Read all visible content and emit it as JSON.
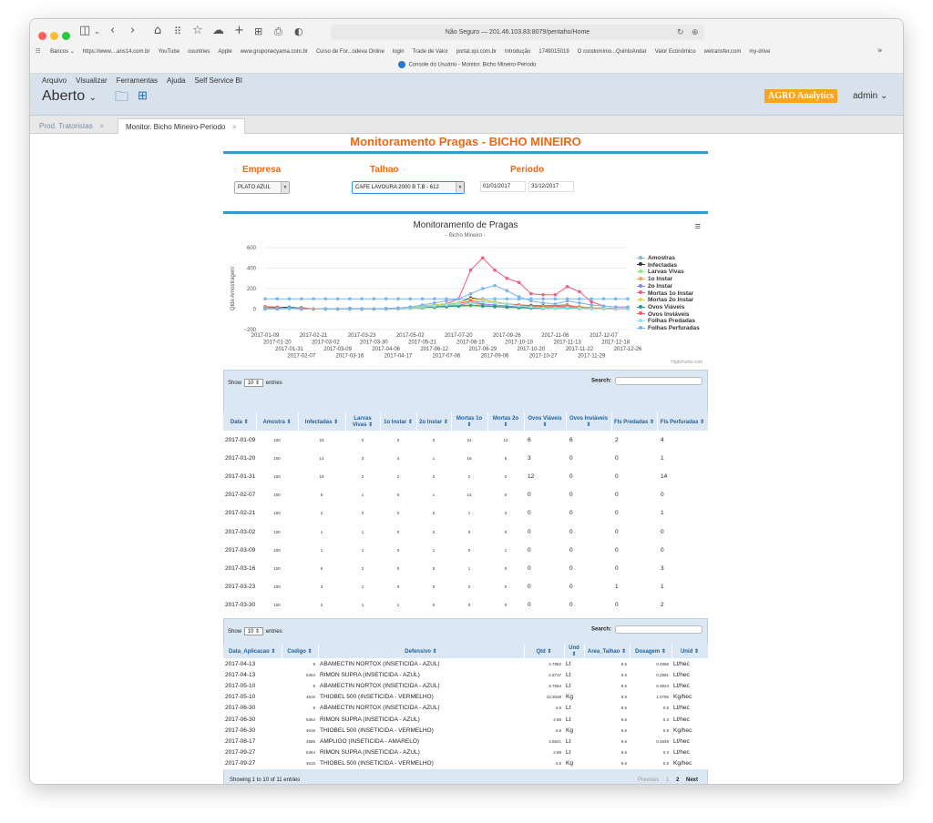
{
  "browser": {
    "url_prefix": "Não Seguro — ",
    "url": "201.46.103.83:8079/pentaho/Home",
    "tab_title": "Console do Usuário - Monitor. Bicho Mineiro-Periodo",
    "bookmarks": [
      "Bancos ⌄",
      "https://www....ans14.com.br",
      "YouTube",
      "countries",
      "Apple",
      "www.gruponecyama.com.br",
      "Curso de For...odeva Online",
      "login",
      "Trade de Valor",
      "portal.xpi.com.br",
      "Introdução",
      "1749015019",
      "O condomínio...QuintoAndar",
      "Valor Econômico",
      "wetransfer.com",
      "my-drive"
    ]
  },
  "pentaho": {
    "menu": [
      "Arquivo",
      "Visualizar",
      "Ferramentas",
      "Ajuda",
      "Self Service BI"
    ],
    "perspective": "Aberto",
    "logo": "AGRO Analytics",
    "user": "admin",
    "tabs": [
      {
        "label": "Prod. Tratoristas"
      },
      {
        "label": "Monitor. Bicho Mineiro-Periodo"
      }
    ]
  },
  "dashboard": {
    "title": "Monitoramento Pragas - BICHO MINEIRO",
    "empresa_label": "Empresa",
    "talhao_label": "Talhao",
    "periodo_label": "Periodo",
    "empresa_value": "PLATO AZUL",
    "talhao_value": "CAFE LAVOURA 2000 B T.B - 612",
    "date_from": "01/01/2017",
    "date_to": "31/12/2017"
  },
  "chart_data": {
    "type": "line",
    "title": "Monitoramento de Pragas",
    "subtitle": "- Bicho Mineiro -",
    "ylabel": "Qtde Amostragem",
    "ylim": [
      -200,
      600
    ],
    "yticks": [
      "600",
      "400",
      "200",
      "0",
      "−200"
    ],
    "credit": "Highcharts.com",
    "grid": true,
    "legend_position": "right",
    "x": [
      "2017-01-09",
      "2017-01-20",
      "2017-01-31",
      "2017-02-07",
      "2017-02-21",
      "2017-03-02",
      "2017-03-09",
      "2017-03-16",
      "2017-03-23",
      "2017-03-30",
      "2017-04-06",
      "2017-04-17",
      "2017-05-02",
      "2017-05-21",
      "2017-06-12",
      "2017-07-06",
      "2017-07-20",
      "2017-08-15",
      "2017-08-29",
      "2017-09-06",
      "2017-09-26",
      "2017-10-10",
      "2017-10-20",
      "2017-10-27",
      "2017-11-06",
      "2017-11-13",
      "2017-11-22",
      "2017-11-29",
      "2017-12-07",
      "2017-12-18",
      "2017-12-26"
    ],
    "series": [
      {
        "name": "Amostras",
        "color": "#7cb5ec",
        "values": [
          100,
          100,
          100,
          100,
          100,
          100,
          100,
          100,
          100,
          100,
          100,
          100,
          100,
          100,
          100,
          100,
          100,
          100,
          100,
          100,
          100,
          100,
          100,
          100,
          100,
          100,
          100,
          100,
          100,
          100,
          100
        ]
      },
      {
        "name": "Infectadas",
        "color": "#333333",
        "values": [
          15,
          14,
          19,
          8,
          2,
          1,
          1,
          6,
          3,
          2,
          5,
          10,
          20,
          30,
          40,
          50,
          60,
          110,
          90,
          70,
          50,
          40,
          35,
          30,
          35,
          40,
          20,
          15,
          10,
          5,
          5
        ]
      },
      {
        "name": "Larvas Vivas",
        "color": "#90ed7d",
        "values": [
          0,
          3,
          2,
          1,
          0,
          1,
          1,
          2,
          1,
          1,
          0,
          2,
          5,
          10,
          15,
          20,
          25,
          30,
          25,
          20,
          15,
          10,
          8,
          5,
          5,
          8,
          5,
          3,
          2,
          1,
          1
        ]
      },
      {
        "name": "1o Instar",
        "color": "#f7a35c",
        "values": [
          0,
          4,
          2,
          0,
          0,
          0,
          0,
          0,
          0,
          1,
          0,
          5,
          15,
          25,
          30,
          40,
          35,
          60,
          40,
          30,
          20,
          15,
          10,
          5,
          10,
          15,
          10,
          5,
          3,
          1,
          1
        ]
      },
      {
        "name": "2o Instar",
        "color": "#8085e9",
        "values": [
          0,
          1,
          2,
          1,
          0,
          3,
          1,
          5,
          0,
          0,
          0,
          3,
          10,
          20,
          25,
          30,
          35,
          70,
          50,
          40,
          30,
          20,
          15,
          10,
          15,
          20,
          15,
          10,
          5,
          2,
          2
        ]
      },
      {
        "name": "Mortas 1o Instar",
        "color": "#f15c80",
        "values": [
          24,
          19,
          2,
          14,
          1,
          0,
          0,
          1,
          2,
          0,
          5,
          10,
          20,
          30,
          40,
          50,
          100,
          380,
          500,
          380,
          300,
          260,
          150,
          140,
          140,
          220,
          170,
          70,
          30,
          20,
          20
        ]
      },
      {
        "name": "Mortas 2o Instar",
        "color": "#e4d354",
        "values": [
          13,
          6,
          0,
          0,
          3,
          0,
          1,
          0,
          0,
          0,
          5,
          10,
          20,
          30,
          40,
          50,
          60,
          100,
          90,
          70,
          50,
          40,
          30,
          25,
          30,
          35,
          25,
          15,
          10,
          5,
          5
        ]
      },
      {
        "name": "Ovos Viáveis",
        "color": "#2b908f",
        "values": [
          6,
          3,
          12,
          0,
          0,
          0,
          0,
          0,
          0,
          0,
          2,
          5,
          10,
          15,
          20,
          25,
          30,
          40,
          30,
          25,
          20,
          15,
          10,
          8,
          10,
          12,
          8,
          5,
          3,
          2,
          2
        ]
      },
      {
        "name": "Ovos Inviáveis",
        "color": "#f45b5b",
        "values": [
          6,
          0,
          0,
          0,
          0,
          0,
          0,
          0,
          0,
          0,
          2,
          5,
          10,
          20,
          30,
          40,
          50,
          80,
          70,
          60,
          50,
          40,
          30,
          20,
          25,
          30,
          20,
          10,
          5,
          3,
          3
        ]
      },
      {
        "name": "Folhas Predadas",
        "color": "#91e8e1",
        "values": [
          2,
          0,
          0,
          0,
          0,
          0,
          0,
          0,
          1,
          0,
          2,
          5,
          10,
          20,
          30,
          40,
          50,
          60,
          70,
          60,
          50,
          30,
          20,
          10,
          10,
          15,
          10,
          5,
          3,
          2,
          2
        ]
      },
      {
        "name": "Folhas Perfuradas",
        "color": "#7cb5ec",
        "values": [
          4,
          1,
          14,
          0,
          1,
          0,
          0,
          3,
          1,
          2,
          5,
          10,
          20,
          40,
          60,
          80,
          100,
          150,
          200,
          230,
          180,
          120,
          80,
          60,
          50,
          80,
          60,
          40,
          30,
          20,
          20
        ]
      }
    ]
  },
  "table1": {
    "show": "Show",
    "length": "10",
    "entries": "entries",
    "search": "Search:",
    "headers": [
      "Data",
      "Amostra",
      "Infectadas",
      "Larvas Vivas",
      "1o Instar",
      "2o Instar",
      "Mortas 1o",
      "Mortas 2o",
      "Ovos Viáveis",
      "Ovos Inviáveis",
      "Fls Predadas",
      "Fls Perfuradas"
    ],
    "rows": [
      [
        "2017-01-09",
        "100",
        "15",
        "0",
        "0",
        "0",
        "24",
        "13",
        "6",
        "6",
        "2",
        "4"
      ],
      [
        "2017-01-20",
        "100",
        "14",
        "3",
        "4",
        "1",
        "19",
        "6",
        "3",
        "0",
        "0",
        "1"
      ],
      [
        "2017-01-31",
        "100",
        "19",
        "2",
        "2",
        "2",
        "2",
        "0",
        "12",
        "0",
        "0",
        "14"
      ],
      [
        "2017-02-07",
        "100",
        "8",
        "1",
        "0",
        "1",
        "14",
        "0",
        "0",
        "0",
        "0",
        "0"
      ],
      [
        "2017-02-21",
        "100",
        "2",
        "0",
        "0",
        "0",
        "1",
        "3",
        "0",
        "0",
        "0",
        "1"
      ],
      [
        "2017-03-02",
        "100",
        "1",
        "1",
        "0",
        "3",
        "0",
        "0",
        "0",
        "0",
        "0",
        "0"
      ],
      [
        "2017-03-09",
        "100",
        "1",
        "1",
        "0",
        "1",
        "0",
        "1",
        "0",
        "0",
        "0",
        "0"
      ],
      [
        "2017-03-16",
        "100",
        "6",
        "2",
        "0",
        "5",
        "1",
        "0",
        "0",
        "0",
        "0",
        "3"
      ],
      [
        "2017-03-23",
        "100",
        "3",
        "1",
        "0",
        "0",
        "2",
        "0",
        "0",
        "0",
        "1",
        "1"
      ],
      [
        "2017-03-30",
        "100",
        "2",
        "1",
        "1",
        "0",
        "0",
        "0",
        "0",
        "0",
        "0",
        "2"
      ]
    ]
  },
  "table2": {
    "show": "Show",
    "length": "10",
    "entries": "entries",
    "search": "Search:",
    "headers": [
      "Data_Aplicacao",
      "Codigo",
      "Defensivo",
      "Qtd",
      "Und",
      "Area_Talhao",
      "Dosagem",
      "Unid"
    ],
    "rows": [
      [
        "2017-04-13",
        "9",
        "ABAMECTIN NORTOX (INSETICIDA - AZUL)",
        "4.7862",
        "Lt",
        "9.6",
        "0.4986",
        "Lt/hec"
      ],
      [
        "2017-04-13",
        "6364",
        "RIMON SUPRA (INSETICIDA - AZUL)",
        "2.8717",
        "Lt",
        "9.6",
        "0.2991",
        "Lt/hec"
      ],
      [
        "2017-05-10",
        "9",
        "ABAMECTIN NORTOX (INSETICIDA - AZUL)",
        "3.7664",
        "Lt",
        "9.6",
        "0.3923",
        "Lt/hec"
      ],
      [
        "2017-05-10",
        "4615",
        "THIOBEL 500 (INSETICIDA - VERMELHO)",
        "10.3638",
        "Kg",
        "9.6",
        "1.0796",
        "Kg/hec"
      ],
      [
        "2017-06-30",
        "9",
        "ABAMECTIN NORTOX (INSETICIDA - AZUL)",
        "4.8",
        "Lt",
        "9.6",
        "0.5",
        "Lt/hec"
      ],
      [
        "2017-06-30",
        "6364",
        "RIMON SUPRA (INSETICIDA - AZUL)",
        "2.88",
        "Lt",
        "9.6",
        "0.3",
        "Lt/hec"
      ],
      [
        "2017-06-30",
        "4615",
        "THIOBEL 500 (INSETICIDA - VERMELHO)",
        "4.8",
        "Kg",
        "9.6",
        "0.5",
        "Kg/hec"
      ],
      [
        "2017-08-17",
        "3585",
        "AMPLIGO (INSETICIDA - AMARELO)",
        "4.6621",
        "Lt",
        "9.6",
        "0.4848",
        "Lt/hec"
      ],
      [
        "2017-09-27",
        "6364",
        "RIMON SUPRA (INSETICIDA - AZUL)",
        "2.88",
        "Lt",
        "9.6",
        "0.3",
        "Lt/hec"
      ],
      [
        "2017-09-27",
        "4615",
        "THIOBEL 500 (INSETICIDA - VERMELHO)",
        "4.8",
        "Kg",
        "9.6",
        "0.5",
        "Kg/hec"
      ]
    ],
    "info": "Showing 1 to 10 of 11 entries",
    "prev": "Previous",
    "page1": "1",
    "page2": "2",
    "next": "Next"
  }
}
